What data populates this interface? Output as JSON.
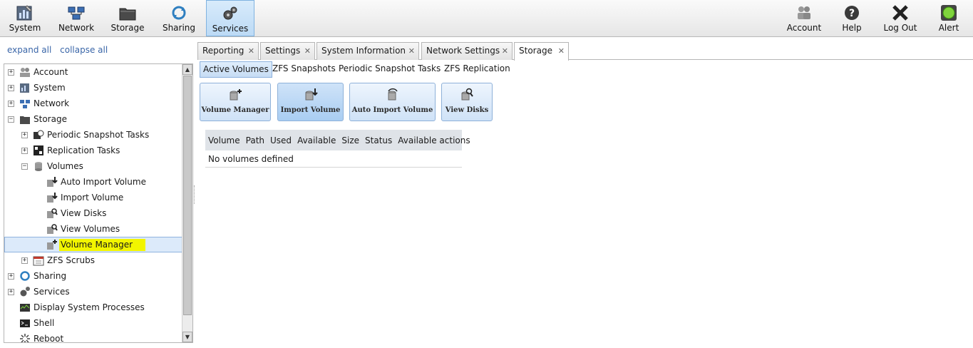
{
  "toolbar": {
    "left": [
      {
        "label": "System",
        "icon": "system-icon"
      },
      {
        "label": "Network",
        "icon": "network-icon"
      },
      {
        "label": "Storage",
        "icon": "storage-icon"
      },
      {
        "label": "Sharing",
        "icon": "sharing-icon"
      },
      {
        "label": "Services",
        "icon": "services-icon",
        "active": true
      }
    ],
    "right": [
      {
        "label": "Account",
        "icon": "account-icon"
      },
      {
        "label": "Help",
        "icon": "help-icon"
      },
      {
        "label": "Log Out",
        "icon": "logout-icon"
      },
      {
        "label": "Alert",
        "icon": "alert-icon"
      }
    ]
  },
  "tree_links": {
    "expand": "expand all",
    "collapse": "collapse all"
  },
  "tree": [
    {
      "label": "Account",
      "expander": "+",
      "level": 0,
      "icon": "account-icon"
    },
    {
      "label": "System",
      "expander": "+",
      "level": 0,
      "icon": "system-icon"
    },
    {
      "label": "Network",
      "expander": "+",
      "level": 0,
      "icon": "network-icon"
    },
    {
      "label": "Storage",
      "expander": "−",
      "level": 0,
      "icon": "storage-icon"
    },
    {
      "label": "Periodic Snapshot Tasks",
      "expander": "+",
      "level": 1,
      "icon": "snapshot-icon"
    },
    {
      "label": "Replication Tasks",
      "expander": "+",
      "level": 1,
      "icon": "replication-icon"
    },
    {
      "label": "Volumes",
      "expander": "−",
      "level": 1,
      "icon": "volumes-icon"
    },
    {
      "label": "Auto Import Volume",
      "expander": "",
      "level": 2,
      "icon": "auto-import-icon"
    },
    {
      "label": "Import Volume",
      "expander": "",
      "level": 2,
      "icon": "import-icon"
    },
    {
      "label": "View Disks",
      "expander": "",
      "level": 2,
      "icon": "view-disks-icon"
    },
    {
      "label": "View Volumes",
      "expander": "",
      "level": 2,
      "icon": "view-volumes-icon"
    },
    {
      "label": "Volume Manager",
      "expander": "",
      "level": 2,
      "icon": "volume-manager-icon",
      "selected": true
    },
    {
      "label": "ZFS Scrubs",
      "expander": "+",
      "level": 1,
      "icon": "calendar-icon"
    },
    {
      "label": "Sharing",
      "expander": "+",
      "level": 0,
      "icon": "sharing-icon"
    },
    {
      "label": "Services",
      "expander": "+",
      "level": 0,
      "icon": "services-icon"
    },
    {
      "label": "Display System Processes",
      "expander": "",
      "level": 0,
      "icon": "processes-icon"
    },
    {
      "label": "Shell",
      "expander": "",
      "level": 0,
      "icon": "shell-icon"
    },
    {
      "label": "Reboot",
      "expander": "",
      "level": 0,
      "icon": "reboot-icon"
    }
  ],
  "tabs": [
    {
      "label": "Reporting"
    },
    {
      "label": "Settings"
    },
    {
      "label": "System Information"
    },
    {
      "label": "Network Settings"
    },
    {
      "label": "Storage",
      "active": true
    }
  ],
  "subtabs": [
    {
      "label": "Active Volumes",
      "active": true
    },
    {
      "label": "ZFS Snapshots"
    },
    {
      "label": "Periodic Snapshot Tasks"
    },
    {
      "label": "ZFS Replication"
    }
  ],
  "actions": [
    {
      "label": "Volume Manager",
      "icon": "volume-manager-icon"
    },
    {
      "label": "Import Volume",
      "icon": "import-icon",
      "pressed": true
    },
    {
      "label": "Auto Import Volume",
      "icon": "auto-import-icon"
    },
    {
      "label": "View Disks",
      "icon": "view-disks-icon"
    }
  ],
  "volumes_table": {
    "columns": [
      "Volume",
      "Path",
      "Used",
      "Available",
      "Size",
      "Status",
      "Available actions"
    ],
    "empty_text": "No volumes defined"
  },
  "colors": {
    "highlight": "#f2f500",
    "link": "#3a66a8",
    "accent": "#8eb1d9"
  }
}
